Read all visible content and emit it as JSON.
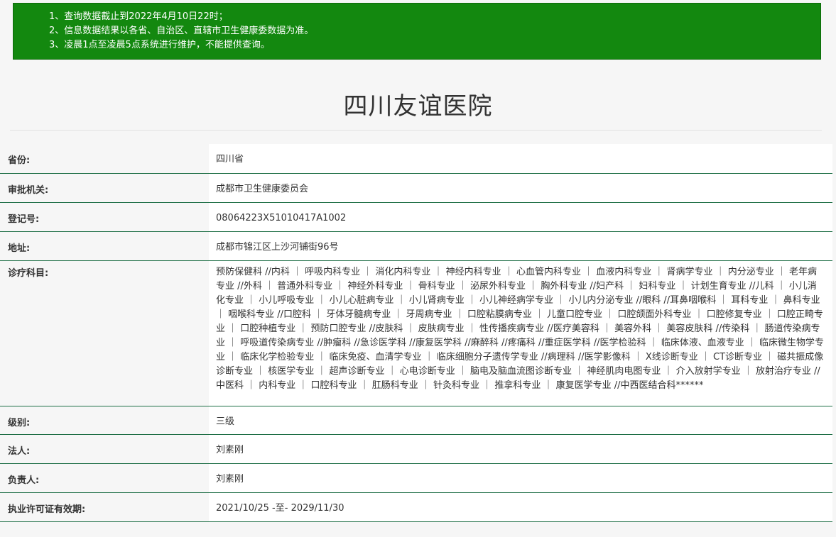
{
  "notice": {
    "lines": [
      "1、查询数据截止到2022年4月10日22时；",
      "2、信息数据结果以各省、自治区、直辖市卫生健康委数据为准。",
      "3、凌晨1点至凌晨5点系统进行维护，不能提供查询。"
    ]
  },
  "page_title": "四川友谊医院",
  "rows": [
    {
      "label": "省份:",
      "value": "四川省"
    },
    {
      "label": "审批机关:",
      "value": "成都市卫生健康委员会"
    },
    {
      "label": "登记号:",
      "value": "08064223X51010417A1002"
    },
    {
      "label": "地址:",
      "value": "成都市锦江区上沙河铺街96号"
    },
    {
      "label": "诊疗科目:",
      "value": "预防保健科 //内科 ｜ 呼吸内科专业 ｜ 消化内科专业 ｜ 神经内科专业 ｜ 心血管内科专业 ｜ 血液内科专业 ｜ 肾病学专业 ｜ 内分泌专业 ｜ 老年病专业 //外科 ｜ 普通外科专业 ｜ 神经外科专业 ｜ 骨科专业 ｜ 泌尿外科专业 ｜ 胸外科专业 //妇产科 ｜ 妇科专业 ｜ 计划生育专业 //儿科 ｜ 小儿消化专业 ｜ 小儿呼吸专业 ｜ 小儿心脏病专业 ｜ 小儿肾病专业 ｜ 小儿神经病学专业 ｜ 小儿内分泌专业 //眼科 //耳鼻咽喉科 ｜ 耳科专业 ｜ 鼻科专业 ｜ 咽喉科专业 //口腔科 ｜ 牙体牙髓病专业 ｜ 牙周病专业 ｜ 口腔粘膜病专业 ｜ 儿童口腔专业 ｜ 口腔颌面外科专业 ｜ 口腔修复专业 ｜ 口腔正畸专业 ｜ 口腔种植专业 ｜ 预防口腔专业 //皮肤科 ｜ 皮肤病专业 ｜ 性传播疾病专业 //医疗美容科 ｜ 美容外科 ｜ 美容皮肤科 //传染科 ｜ 肠道传染病专业 ｜ 呼吸道传染病专业 //肿瘤科 //急诊医学科 //康复医学科 //麻醉科 //疼痛科 //重症医学科 //医学检验科 ｜ 临床体液、血液专业 ｜ 临床微生物学专业 ｜ 临床化学检验专业 ｜ 临床免疫、血清学专业 ｜ 临床细胞分子遗传学专业 //病理科 //医学影像科 ｜ X线诊断专业 ｜ CT诊断专业 ｜ 磁共振成像诊断专业 ｜ 核医学专业 ｜ 超声诊断专业 ｜ 心电诊断专业 ｜ 脑电及脑血流图诊断专业 ｜ 神经肌肉电图专业 ｜ 介入放射学专业 ｜ 放射治疗专业 //中医科 ｜ 内科专业 ｜ 口腔科专业 ｜ 肛肠科专业 ｜ 针灸科专业 ｜ 推拿科专业 ｜ 康复医学专业 //中西医结合科******"
    },
    {
      "label": "级别:",
      "value": "三级"
    },
    {
      "label": "法人:",
      "value": "刘素刚"
    },
    {
      "label": "负责人:",
      "value": "刘素刚"
    },
    {
      "label": "执业许可证有效期:",
      "value": "2021/10/25 -至- 2029/11/30"
    }
  ],
  "colors": {
    "notice_bg": "#13880f",
    "row_border": "#1d6e45",
    "page_bg": "#f6f6f6"
  }
}
